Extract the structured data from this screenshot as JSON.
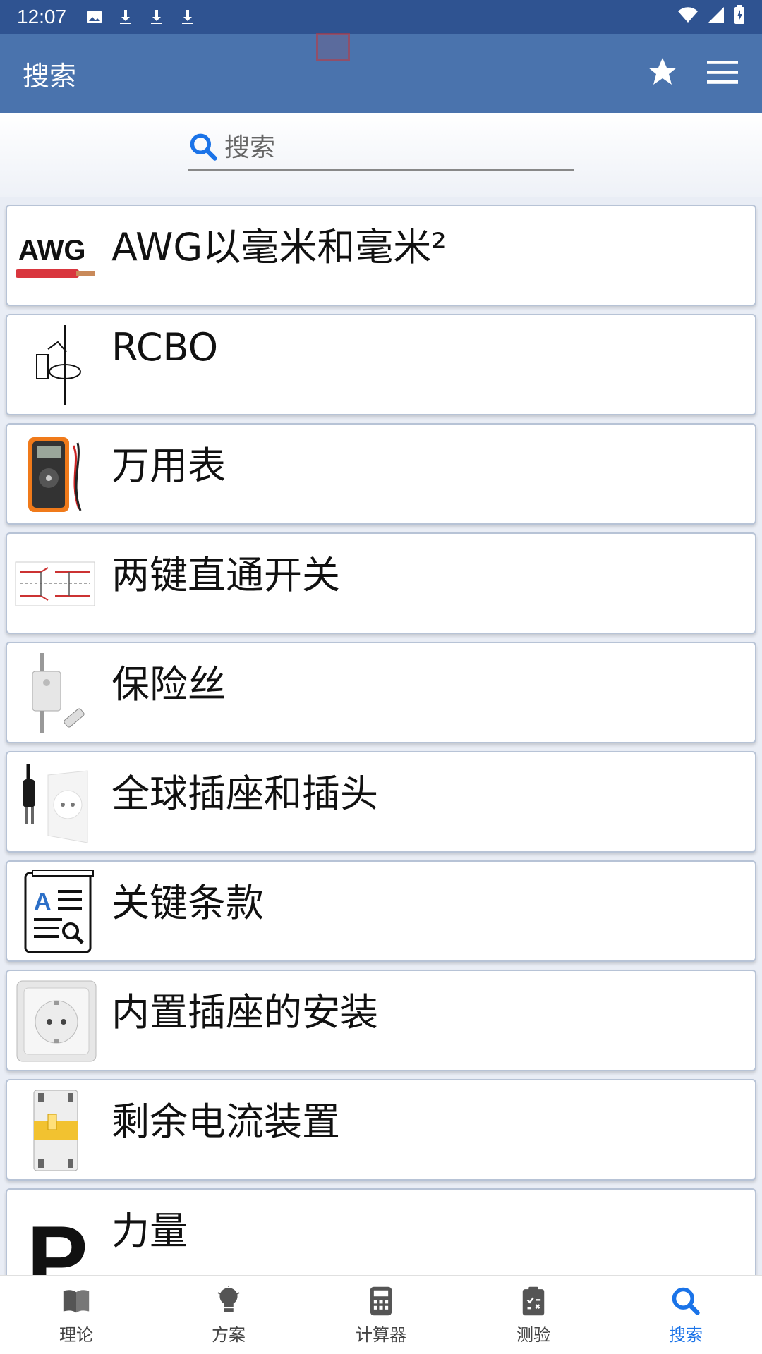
{
  "status_bar": {
    "time": "12:07"
  },
  "app_bar": {
    "title": "搜索"
  },
  "search": {
    "placeholder": "搜索",
    "value": ""
  },
  "items": [
    {
      "label": "AWG以毫米和毫米²",
      "thumb_text": "AWG"
    },
    {
      "label": "RCBO"
    },
    {
      "label": "万用表"
    },
    {
      "label": "两键直通开关"
    },
    {
      "label": "保险丝"
    },
    {
      "label": "全球插座和插头"
    },
    {
      "label": "关键条款",
      "thumb_text": "A"
    },
    {
      "label": "内置插座的安装"
    },
    {
      "label": "剩余电流装置"
    },
    {
      "label": "力量",
      "thumb_text": "P"
    }
  ],
  "bottom_nav": [
    {
      "label": "理论",
      "icon": "book-icon"
    },
    {
      "label": "方案",
      "icon": "bulb-icon"
    },
    {
      "label": "计算器",
      "icon": "calculator-icon"
    },
    {
      "label": "测验",
      "icon": "clipboard-icon"
    },
    {
      "label": "搜索",
      "icon": "search-icon",
      "active": true
    }
  ],
  "colors": {
    "status_bar": "#2f5391",
    "app_bar": "#4a73ad",
    "active_nav": "#1a73e8"
  }
}
